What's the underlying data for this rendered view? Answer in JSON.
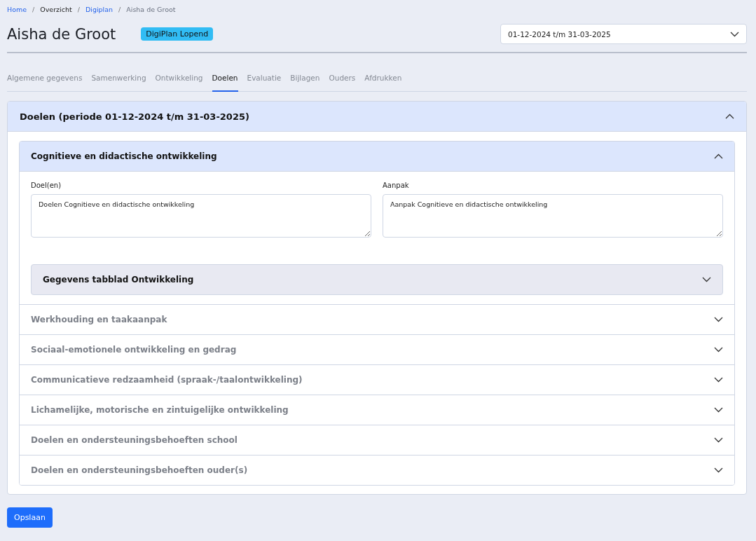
{
  "breadcrumb": [
    {
      "label": "Home",
      "kind": "link"
    },
    {
      "label": "Overzicht",
      "kind": "plain"
    },
    {
      "label": "Digiplan",
      "kind": "link"
    },
    {
      "label": "Aisha de Groot",
      "kind": "current"
    }
  ],
  "breadcrumb_separator": "/",
  "title": "Aisha de Groot",
  "badge": "DigiPlan Lopend",
  "period_select": {
    "value": "01-12-2024 t/m 31-03-2025"
  },
  "tabs": [
    {
      "label": "Algemene gegevens",
      "selected": false
    },
    {
      "label": "Samenwerking",
      "selected": false
    },
    {
      "label": "Ontwikkeling",
      "selected": false
    },
    {
      "label": "Doelen",
      "selected": true
    },
    {
      "label": "Evaluatie",
      "selected": false
    },
    {
      "label": "Bijlagen",
      "selected": false
    },
    {
      "label": "Ouders",
      "selected": false
    },
    {
      "label": "Afdrukken",
      "selected": false
    }
  ],
  "section": {
    "title": "Doelen (periode 01-12-2024 t/m 31-03-2025)",
    "expanded": true,
    "subsections": [
      {
        "title": "Cognitieve en didactische ontwikkeling",
        "expanded": true,
        "fields": [
          {
            "label": "Doel(en)",
            "value": "Doelen Cognitieve en didactische ontwikkeling"
          },
          {
            "label": "Aanpak",
            "value": "Aanpak Cognitieve en didactische ontwikkeling"
          }
        ],
        "inner": {
          "title": "Gegevens tabblad Ontwikkeling",
          "expanded": false
        }
      },
      {
        "title": "Werkhouding en taakaanpak",
        "expanded": false
      },
      {
        "title": "Sociaal-emotionele ontwikkeling en gedrag",
        "expanded": false
      },
      {
        "title": "Communicatieve redzaamheid (spraak-/taalontwikkeling)",
        "expanded": false
      },
      {
        "title": "Lichamelijke, motorische en zintuigelijke ontwikkeling",
        "expanded": false
      },
      {
        "title": "Doelen en ondersteuningsbehoeften school",
        "expanded": false
      },
      {
        "title": "Doelen en ondersteuningsbehoeften ouder(s)",
        "expanded": false
      }
    ]
  },
  "save_button": "Opslaan"
}
